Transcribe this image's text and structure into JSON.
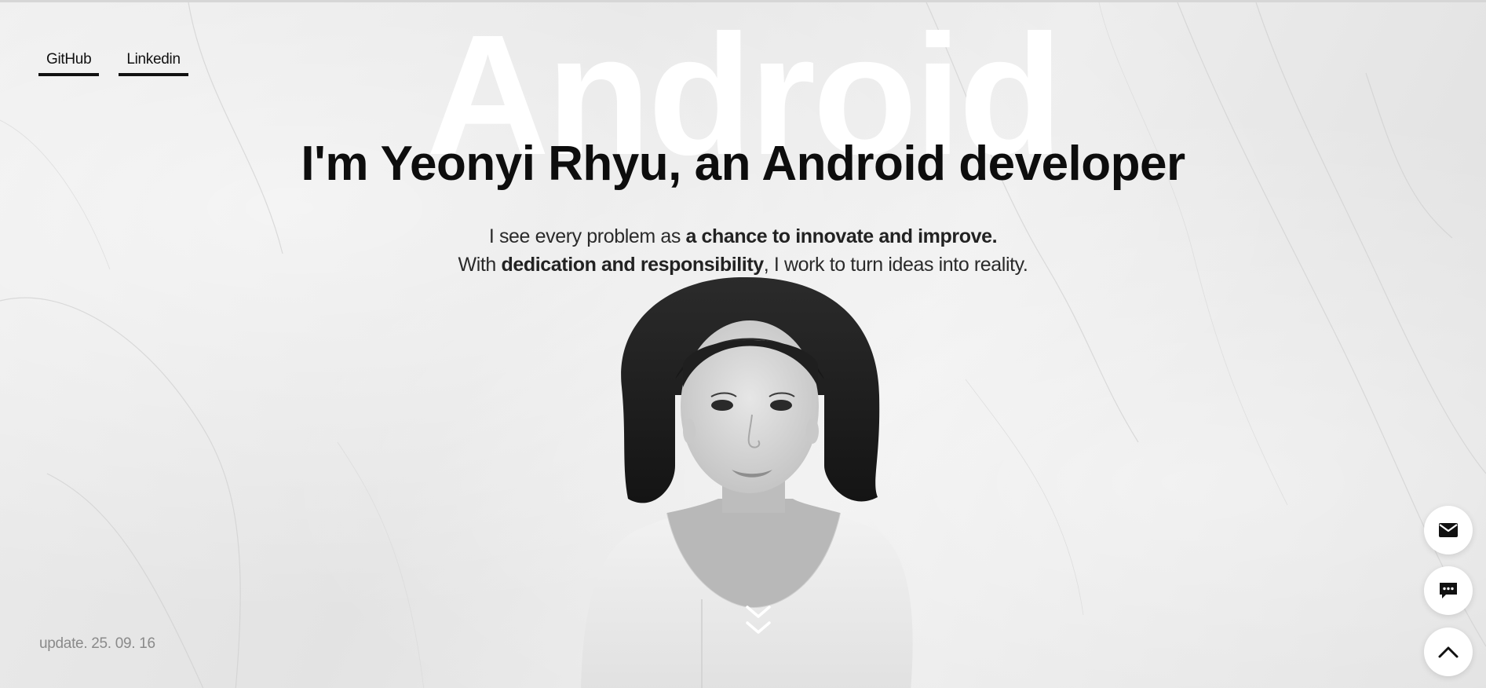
{
  "nav": {
    "links": [
      {
        "label": "GitHub"
      },
      {
        "label": "Linkedin"
      }
    ]
  },
  "hero": {
    "background_word": "Android",
    "headline": {
      "prefix": "I'm ",
      "name": "Yeonyi Rhyu",
      "suffix": ", an Android developer"
    },
    "tagline": {
      "line1_prefix": "I see every problem as ",
      "line1_bold": "a chance to innovate and improve.",
      "line2_prefix": "With ",
      "line2_bold": "dedication and responsibility",
      "line2_suffix": ", I work to turn ideas into reality."
    }
  },
  "footer": {
    "update_note": "update. 25. 09. 16"
  },
  "floating_actions": [
    {
      "icon": "mail-icon"
    },
    {
      "icon": "chat-icon"
    },
    {
      "icon": "chevron-up-icon"
    }
  ],
  "colors": {
    "text": "#0d0d0d",
    "background": "#e9e9e9",
    "accent": "#111111",
    "muted": "#8a8a8a"
  }
}
